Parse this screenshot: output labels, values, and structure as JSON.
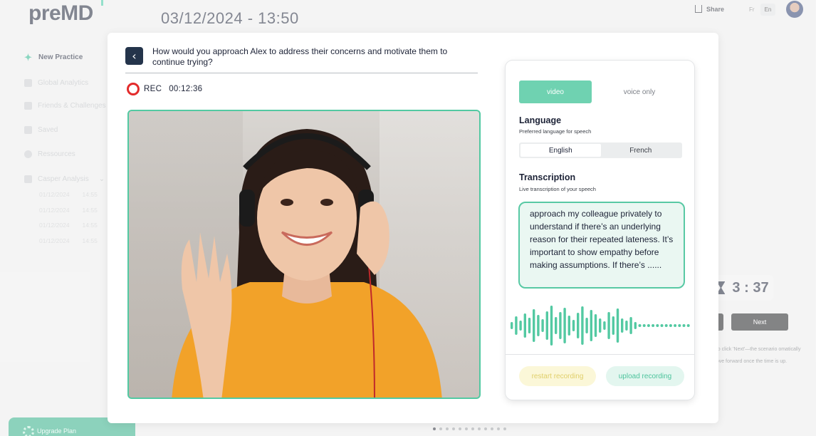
{
  "app": {
    "logo": "preMD",
    "datetime": "03/12/2024  -  13:50"
  },
  "header": {
    "share_label": "Share",
    "lang_fr": "Fr",
    "lang_en": "En"
  },
  "sidebar": {
    "items": [
      {
        "label": "New Practice",
        "icon": "sparkle-icon"
      },
      {
        "label": "Global Analytics",
        "icon": "analytics-icon"
      },
      {
        "label": "Friends & Challenges",
        "icon": "friends-icon"
      },
      {
        "label": "Saved",
        "icon": "bookmark-icon"
      },
      {
        "label": "Ressources",
        "icon": "globe-icon"
      },
      {
        "label": "Casper Analysis",
        "icon": "bar-chart-icon"
      }
    ],
    "sub_items": [
      {
        "date": "01/12/2024",
        "time": "14:55"
      },
      {
        "date": "01/12/2024",
        "time": "14:55"
      },
      {
        "date": "01/12/2024",
        "time": "14:55"
      },
      {
        "date": "01/12/2024",
        "time": "14:55"
      }
    ],
    "upgrade_label": "Upgrade Plan"
  },
  "modal": {
    "question": "How would you approach Alex to address their concerns and motivate them to continue trying?",
    "rec_label": "REC",
    "rec_time": "00:12:36"
  },
  "panel": {
    "mode_video": "video",
    "mode_voice": "voice only",
    "language_title": "Language",
    "language_sub": "Preferred language for speech",
    "lang_english": "English",
    "lang_french": "French",
    "transcription_title": "Transcription",
    "transcription_sub": "Live transcription of your speech",
    "transcription_text": "approach my colleague privately to understand if there’s an underlying reason for their repeated lateness. It’s important to show empathy before making assumptions. If there’s ......",
    "restart_label": "restart recording",
    "upload_label": "upload recording"
  },
  "background": {
    "timer": "3 : 37",
    "next_label": "Next",
    "hint": "d to click 'Next'—the scenario omatically move forward once the time is up.",
    "pagination_count": 12,
    "pagination_active": 1
  },
  "colors": {
    "accent": "#53c9a2",
    "rec": "#e32b2b",
    "navy": "#24344b"
  }
}
